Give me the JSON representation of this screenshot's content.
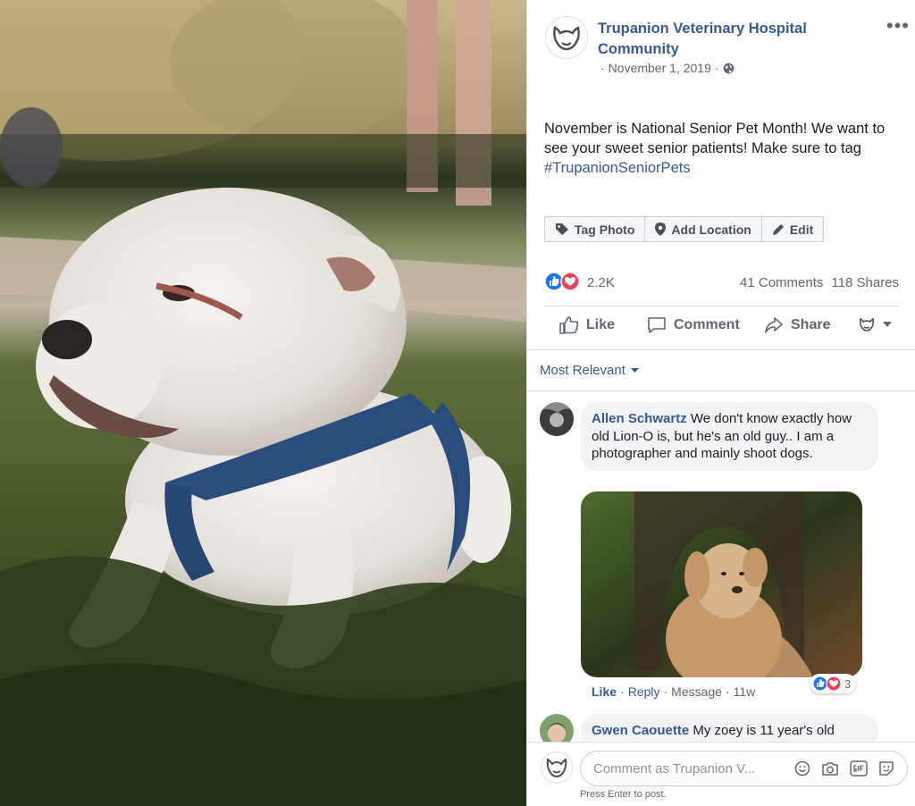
{
  "post": {
    "page_name": "Trupanion Veterinary Hospital Community",
    "date": "November 1, 2019",
    "text": "November is National Senior Pet Month! We want to see your sweet senior patients! Make sure to tag",
    "hashtag": "#TrupanionSeniorPets",
    "more_icon": "more-horizontal-icon",
    "privacy_icon": "globe-icon"
  },
  "photo_tools": {
    "tag_photo": "Tag Photo",
    "add_location": "Add Location",
    "edit": "Edit"
  },
  "stats": {
    "reactions": "2.2K",
    "comments": "41 Comments",
    "shares": "118 Shares"
  },
  "actions": {
    "like": "Like",
    "comment": "Comment",
    "share": "Share"
  },
  "sort": {
    "label": "Most Relevant"
  },
  "comments": [
    {
      "author": "Allen Schwartz",
      "text": "We don't know exactly how old Lion-O is, but he's an old guy.. I am a photographer and mainly shoot dogs.",
      "like": "Like",
      "reply": "Reply",
      "message": "Message",
      "age": "11w",
      "reaction_count": "3"
    },
    {
      "author": "Gwen Caouette",
      "text": "My zoey is 11 year's old"
    }
  ],
  "composer": {
    "placeholder": "Comment as Trupanion V...",
    "hint": "Press Enter to post."
  },
  "colors": {
    "link": "#385898",
    "like_blue": "#1877f2",
    "love_red": "#f33e58",
    "bubble": "#f2f3f5"
  }
}
